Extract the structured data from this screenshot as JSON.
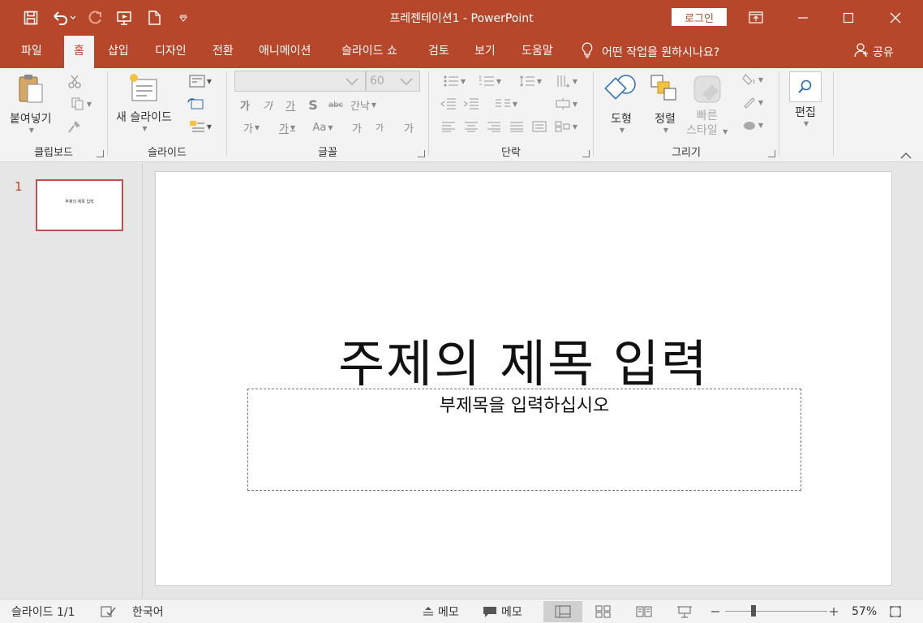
{
  "window": {
    "title": "프레젠테이션1",
    "separator": " - ",
    "app_name": "PowerPoint",
    "login_label": "로그인"
  },
  "tabs": [
    {
      "label": "파일"
    },
    {
      "label": "홈",
      "active": true
    },
    {
      "label": "삽입"
    },
    {
      "label": "디자인"
    },
    {
      "label": "전환"
    },
    {
      "label": "애니메이션"
    },
    {
      "label": "슬라이드 쇼"
    },
    {
      "label": "검토"
    },
    {
      "label": "보기"
    },
    {
      "label": "도움말"
    }
  ],
  "tell_me": "어떤 작업을 원하시나요?",
  "share_label": "공유",
  "ribbon": {
    "clipboard": {
      "paste_label": "붙여넣기",
      "group_label": "클립보드"
    },
    "slides": {
      "new_slide_label": "새 슬라이드",
      "group_label": "슬라이드"
    },
    "font": {
      "font_size": "60",
      "group_label": "글꼴",
      "bold": "가",
      "italic": "가",
      "underline": "가",
      "shadow": "S",
      "strike": "abc",
      "spacing": "간낙",
      "case": "Aa",
      "grow": "가",
      "shrink": "가",
      "clear": "가",
      "highlight": "가",
      "color": "가"
    },
    "paragraph": {
      "group_label": "단락"
    },
    "drawing": {
      "shapes_label": "도형",
      "arrange_label": "정렬",
      "quick_styles_line1": "빠른",
      "quick_styles_line2": "스타일",
      "group_label": "그리기"
    },
    "editing": {
      "label": "편집"
    }
  },
  "thumbnails": [
    {
      "number": "1",
      "title": "주제의 제목 입력"
    }
  ],
  "slide": {
    "title": "주제의 제목 입력",
    "subtitle": "부제목을 입력하십시오"
  },
  "status": {
    "slide_count": "슬라이드 1/1",
    "language": "한국어",
    "notes_label": "메모",
    "comments_label": "메모",
    "zoom": "57%"
  },
  "colors": {
    "accent": "#b7472a",
    "ribbon_bg": "#f3f3f3",
    "workspace_bg": "#e6e6e6"
  }
}
